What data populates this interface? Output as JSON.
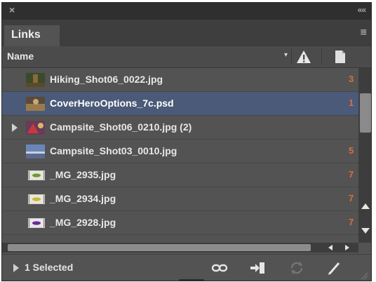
{
  "panel": {
    "close_glyph": "×",
    "collapse_glyph": "««",
    "tab_label": "Links",
    "menu_glyph": "≡"
  },
  "header": {
    "name_label": "Name",
    "sort_glyph": "▾",
    "warning_icon": "warning-icon",
    "page_icon": "page-icon"
  },
  "rows": [
    {
      "name": "Hiking_Shot06_0022.jpg",
      "page": "3",
      "thumb": "hiking-thumbnail"
    },
    {
      "name": "CoverHeroOptions_7c.psd",
      "page": "1",
      "thumb": "cover-thumbnail"
    },
    {
      "name": "Campsite_Shot06_0210.jpg (2)",
      "page": "",
      "thumb": "campsite-thumbnail"
    },
    {
      "name": "Campsite_Shot03_0010.jpg",
      "page": "5",
      "thumb": "campsite-landscape-thumbnail"
    },
    {
      "name": "_MG_2935.jpg",
      "page": "7",
      "thumb": "product-thumbnail-green"
    },
    {
      "name": "_MG_2934.jpg",
      "page": "7",
      "thumb": "product-thumbnail-yellow"
    },
    {
      "name": "_MG_2928.jpg",
      "page": "7",
      "thumb": "product-thumbnail-purple"
    }
  ],
  "footer": {
    "status": "1 Selected"
  },
  "colors": {
    "panel_bg": "#535353",
    "selected_row": "#4a5a78",
    "page_number": "#d4703a"
  }
}
